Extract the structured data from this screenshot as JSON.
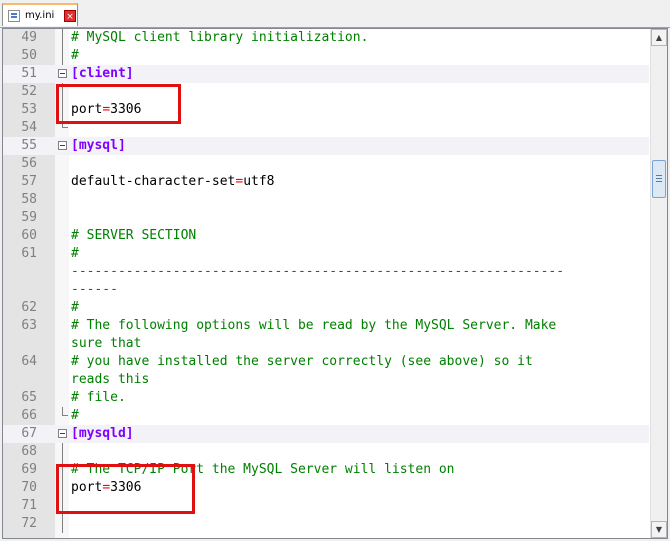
{
  "tab": {
    "filename": "my.ini",
    "close_glyph": "×"
  },
  "editor": {
    "lines": [
      {
        "num": "49",
        "text": "# MySQL client library initialization.",
        "type": "comment"
      },
      {
        "num": "50",
        "text": "#",
        "type": "comment"
      },
      {
        "num": "51",
        "text": "[client]",
        "type": "section"
      },
      {
        "num": "52",
        "text": "",
        "type": "blank"
      },
      {
        "num": "53",
        "key": "port",
        "op": "=",
        "val": "3306",
        "type": "kv"
      },
      {
        "num": "54",
        "text": "",
        "type": "blank"
      },
      {
        "num": "55",
        "text": "[mysql]",
        "type": "section"
      },
      {
        "num": "56",
        "text": "",
        "type": "blank"
      },
      {
        "num": "57",
        "key": "default-character-set",
        "op": "=",
        "val": "utf8",
        "type": "kv"
      },
      {
        "num": "58",
        "text": "",
        "type": "blank"
      },
      {
        "num": "59",
        "text": "",
        "type": "blank"
      },
      {
        "num": "60",
        "text": "# SERVER SECTION",
        "type": "comment"
      },
      {
        "num": "61",
        "text": "#",
        "type": "comment"
      },
      {
        "num": "",
        "text": "---------------------------------------------------------------",
        "type": "comment"
      },
      {
        "num": "",
        "text": "------",
        "type": "comment"
      },
      {
        "num": "62",
        "text": "#",
        "type": "comment"
      },
      {
        "num": "63",
        "text": "# The following options will be read by the MySQL Server. Make",
        "type": "comment"
      },
      {
        "num": "",
        "text": "sure that",
        "type": "comment"
      },
      {
        "num": "64",
        "text": "# you have installed the server correctly (see above) so it",
        "type": "comment"
      },
      {
        "num": "",
        "text": "reads this",
        "type": "comment"
      },
      {
        "num": "65",
        "text": "# file.",
        "type": "comment"
      },
      {
        "num": "66",
        "text": "#",
        "type": "comment"
      },
      {
        "num": "67",
        "text": "[mysqld]",
        "type": "section"
      },
      {
        "num": "68",
        "text": "",
        "type": "blank"
      },
      {
        "num": "69",
        "text": "# The TCP/IP Port the MySQL Server will listen on",
        "type": "comment"
      },
      {
        "num": "70",
        "key": "port",
        "op": "=",
        "val": "3306",
        "type": "kv"
      },
      {
        "num": "71",
        "text": "",
        "type": "blank"
      },
      {
        "num": "72",
        "text": "",
        "type": "blank"
      }
    ]
  },
  "scrollbar": {
    "up_glyph": "▲",
    "down_glyph": "▼",
    "position_fraction": 0.26
  }
}
